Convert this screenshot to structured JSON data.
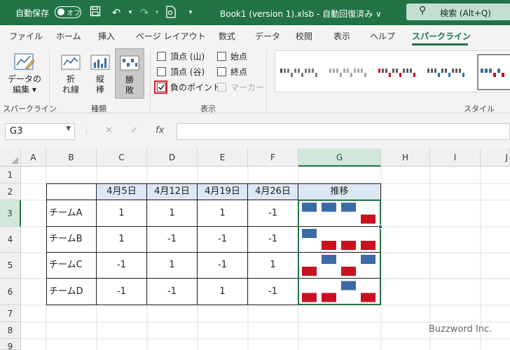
{
  "titlebar": {
    "autosave_label": "自動保存",
    "autosave_state": "オフ",
    "doc_title": "Book1 (version 1).xlsb  -  自動回復済み  ∨",
    "search_label": "検索 (Alt+Q)"
  },
  "tabs": [
    "ファイル",
    "ホーム",
    "挿入",
    "ページ レイアウト",
    "数式",
    "データ",
    "校閲",
    "表示",
    "ヘルプ",
    "スパークライン"
  ],
  "active_tab": "スパークライン",
  "ribbon": {
    "edit_data": {
      "line1": "データの",
      "line2": "編集 ▾"
    },
    "group_sparkline": "スパークライン",
    "type_line": {
      "line1": "折",
      "line2": "れ線"
    },
    "type_column": {
      "line1": "縦",
      "line2": "棒"
    },
    "type_winloss": {
      "line1": "勝",
      "line2": "敗"
    },
    "group_type": "種類",
    "show": [
      {
        "label": "頂点 (山)",
        "checked": false
      },
      {
        "label": "始点",
        "checked": false
      },
      {
        "label": "頂点 (谷)",
        "checked": false
      },
      {
        "label": "終点",
        "checked": false
      },
      {
        "label": "負のポイント",
        "checked": true
      },
      {
        "label": "マーカー",
        "checked": false,
        "disabled": true
      }
    ],
    "group_show": "表示",
    "group_style": "スタイル"
  },
  "formula_bar": {
    "name_box": "G3",
    "fx": "fx",
    "cancel": "✕",
    "enter": "✓"
  },
  "columns": [
    "A",
    "B",
    "C",
    "D",
    "E",
    "F",
    "G",
    "H",
    "I",
    "J"
  ],
  "rows": [
    "1",
    "2",
    "3",
    "4",
    "5",
    "6",
    "7",
    "8",
    "9"
  ],
  "table": {
    "header": [
      "4月5日",
      "4月12日",
      "4月19日",
      "4月26日",
      "推移"
    ],
    "teams": [
      {
        "name": "チームA",
        "values": [
          1,
          1,
          1,
          -1
        ]
      },
      {
        "name": "チームB",
        "values": [
          1,
          -1,
          -1,
          -1
        ]
      },
      {
        "name": "チームC",
        "values": [
          -1,
          1,
          -1,
          1
        ]
      },
      {
        "name": "チームD",
        "values": [
          -1,
          -1,
          1,
          -1
        ]
      }
    ],
    "display": [
      [
        "1",
        "1",
        "1",
        "-1"
      ],
      [
        "1",
        "-1",
        "-1",
        "-1"
      ],
      [
        "-1",
        "1",
        "-1",
        "1"
      ],
      [
        "-1",
        "-1",
        "1",
        "-1"
      ]
    ]
  },
  "colors": {
    "accent": "#217346",
    "positive_bar": "#3c6aa6",
    "negative_bar": "#c8101f",
    "header_fill": "#dce8f3"
  },
  "watermark": "Buzzword Inc."
}
